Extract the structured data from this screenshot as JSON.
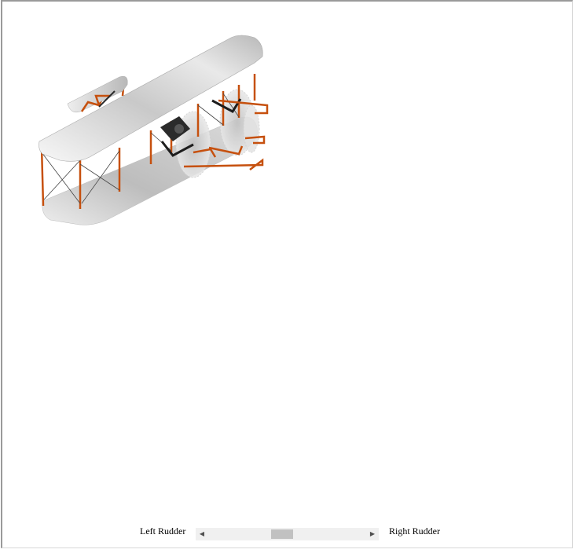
{
  "scene": {
    "model": "biplane",
    "colors": {
      "wing": "#d9d9d9",
      "frame": "#c6500e",
      "wire": "#333333"
    }
  },
  "controls": {
    "left_label": "Left Rudder",
    "right_label": "Right Rudder",
    "arrow_left_icon": "◀",
    "arrow_right_icon": "▶",
    "slider_position": 0.46
  }
}
